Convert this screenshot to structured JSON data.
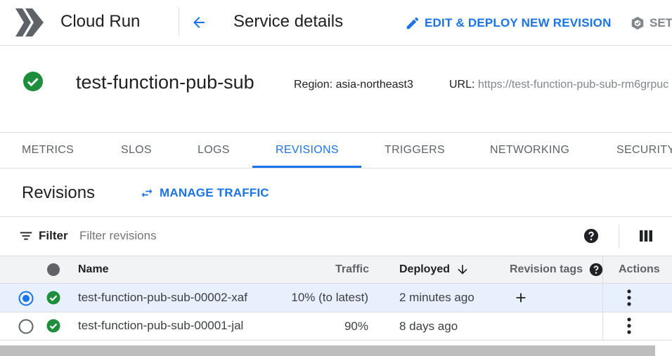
{
  "header": {
    "product_title": "Cloud Run",
    "page_title": "Service details",
    "edit_deploy_label": "EDIT & DEPLOY NEW REVISION",
    "set_label": "SET"
  },
  "service": {
    "name": "test-function-pub-sub",
    "region_label": "Region:",
    "region_value": "asia-northeast3",
    "url_label": "URL:",
    "url_value": "https://test-function-pub-sub-rm6grpuc"
  },
  "tabs": [
    {
      "label": "METRICS"
    },
    {
      "label": "SLOS"
    },
    {
      "label": "LOGS"
    },
    {
      "label": "REVISIONS",
      "active": true
    },
    {
      "label": "TRIGGERS"
    },
    {
      "label": "NETWORKING"
    },
    {
      "label": "SECURITY"
    }
  ],
  "revisions": {
    "title": "Revisions",
    "manage_traffic_label": "MANAGE TRAFFIC",
    "filter_label": "Filter",
    "filter_placeholder": "Filter revisions"
  },
  "table": {
    "columns": {
      "name": "Name",
      "traffic": "Traffic",
      "deployed": "Deployed",
      "tags": "Revision tags",
      "actions": "Actions"
    },
    "rows": [
      {
        "name": "test-function-pub-sub-00002-xaf",
        "traffic": "10% (to latest)",
        "deployed": "2 minutes ago",
        "selected": true
      },
      {
        "name": "test-function-pub-sub-00001-jal",
        "traffic": "90%",
        "deployed": "8 days ago",
        "selected": false
      }
    ]
  },
  "colors": {
    "accent": "#1a73e8",
    "success": "#1e8e3e",
    "border": "#dadce0",
    "selected_row": "#e8f0fe"
  },
  "icons": [
    "cloud-run-logo-icon",
    "back-arrow-icon",
    "pencil-icon",
    "set-icon",
    "status-ok-icon",
    "swap-arrows-icon",
    "filter-icon",
    "help-icon",
    "column-display-icon",
    "status-column-icon",
    "sort-down-icon",
    "radio-selected-icon",
    "radio-empty-icon",
    "add-tag-icon",
    "more-vert-icon"
  ]
}
